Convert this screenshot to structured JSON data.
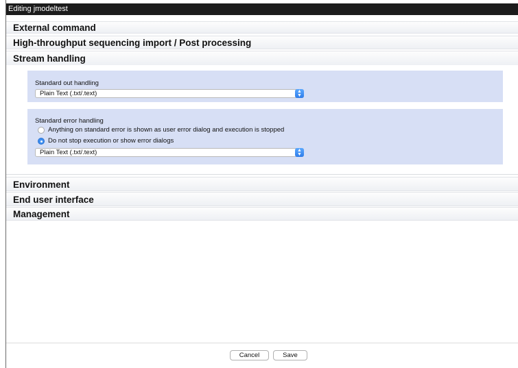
{
  "window": {
    "title": "Editing jmodeltest"
  },
  "sections": {
    "external_command": "External command",
    "hts": "High-throughput sequencing import / Post processing",
    "stream_handling": "Stream handling",
    "environment": "Environment",
    "end_user_interface": "End user interface",
    "management": "Management"
  },
  "stdout": {
    "label": "Standard out handling",
    "selected": "Plain Text (.txt/.text)"
  },
  "stderr": {
    "label": "Standard error handling",
    "options": [
      {
        "label": "Anything on standard error is shown as user error dialog and execution is stopped",
        "selected": false
      },
      {
        "label": "Do not stop execution or show error dialogs",
        "selected": true
      }
    ],
    "selected": "Plain Text (.txt/.text)"
  },
  "buttons": {
    "cancel": "Cancel",
    "save": "Save"
  },
  "colors": {
    "panel_bg": "#d7dff5",
    "accent": "#3d8ef0",
    "titlebar_bg": "#1c1c1c"
  }
}
